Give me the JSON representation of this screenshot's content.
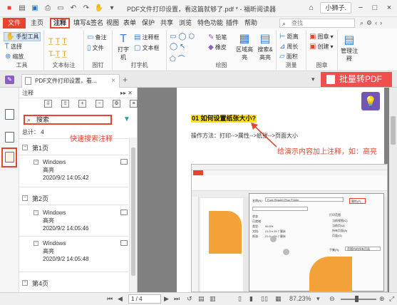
{
  "titlebar": {
    "title": "PDF文件打印设置，看这篇就够了.pdf * - 福昕阅读器",
    "user": "小狮子.",
    "window_controls": [
      "−",
      "□",
      "×"
    ]
  },
  "tabs": {
    "file": "文件",
    "items": [
      "主页",
      "注释",
      "填写&签名",
      "视图",
      "表单",
      "保护",
      "共享",
      "浏览",
      "特色功能",
      "插件",
      "帮助"
    ],
    "active": "注释",
    "search_placeholder": "查找"
  },
  "ribbon": {
    "groups": [
      "工具",
      "文本标注",
      "图钉",
      "打字机",
      "绘图",
      "测量",
      "图章"
    ],
    "tools": [
      "手型工具",
      "选择",
      "缩放"
    ],
    "pin": [
      "备注",
      "文件"
    ],
    "typewriter": [
      "打字机",
      "注释框",
      "文本框"
    ],
    "drawing": [
      "铅笔",
      "橡皮",
      "区域高亮",
      "搜索&高亮"
    ],
    "measure": [
      "距离",
      "周长",
      "面积"
    ],
    "stamp": [
      "图章",
      "创建"
    ],
    "manage": "管理注释"
  },
  "docbar": {
    "doc_tab": "PDF文件打印设置，看...",
    "batch_label": "批量转PDF"
  },
  "panel": {
    "title": "注释",
    "search_value": "搜索",
    "total": "总计： 4",
    "pages": [
      {
        "label": "第1页",
        "comments": [
          {
            "author": "Windows",
            "type": "高亮",
            "time": "2020/9/2 14:05:42"
          }
        ]
      },
      {
        "label": "第2页",
        "comments": [
          {
            "author": "Windows",
            "type": "高亮",
            "time": "2020/9/2 14:05:46"
          },
          {
            "author": "Windows",
            "type": "高亮",
            "time": "2020/9/2 14:05:48"
          }
        ]
      },
      {
        "label": "第4页",
        "comments": []
      }
    ]
  },
  "annotations": {
    "search_hint": "快速搜索注释",
    "highlight_hint": "给演示内容加上注释，如：高亮"
  },
  "document": {
    "heading": "01 如何设置纸张大小?",
    "method": "操作方法：打印-->属性-->纸张-->页面大小",
    "embedded": {
      "printer_label": "名称(N):",
      "printer_value": "Foxit Reader Plus Printer",
      "properties_button": "属性(P)...",
      "status_rows": [
        "状态",
        "已就绪",
        "类型:",
        "99.5%",
        "文档:",
        "21.0 x 29.7 厘米",
        "纸张:",
        "21.0 x 29.7 厘米"
      ],
      "range_title": "打印范围",
      "range_options": [
        "当前视图(C)",
        "当前页(U)",
        "所有页面(A)",
        "页面(G)"
      ],
      "subset": "子集(S):",
      "subset_value": "范围内的所有页面"
    }
  },
  "statusbar": {
    "page": "1 / 4",
    "zoom": "87.23%"
  },
  "colors": {
    "accent": "#e8432e",
    "highlight": "#ffe400",
    "batch": "#ef4f4f",
    "bulb": "#7256b3"
  }
}
